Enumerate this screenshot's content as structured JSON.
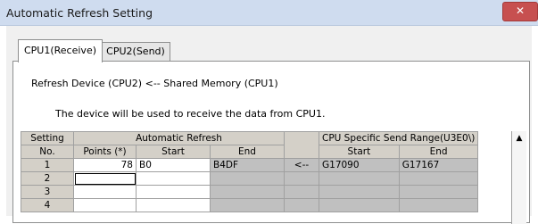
{
  "window": {
    "title": "Automatic Refresh Setting",
    "close_glyph": "✕"
  },
  "tabs": [
    {
      "label": "CPU1(Receive)",
      "active": true
    },
    {
      "label": "CPU2(Send)",
      "active": false
    }
  ],
  "panel": {
    "line1": "Refresh Device (CPU2) <-- Shared Memory (CPU1)",
    "line2": "The device will be used to receive the data from CPU1."
  },
  "table": {
    "headers": {
      "setting": "Setting",
      "no": "No.",
      "auto_refresh": "Automatic Refresh",
      "send_range": "CPU Specific Send Range(U3E0\\)",
      "points": "Points (*)",
      "start": "Start",
      "end": "End",
      "start2": "Start",
      "end2": "End"
    },
    "rows": [
      {
        "no": "1",
        "points": "78",
        "start": "B0",
        "end": "B4DF",
        "arrow": "<--",
        "r_start": "G17090",
        "r_end": "G17167"
      },
      {
        "no": "2",
        "points": "",
        "start": "",
        "end": "",
        "arrow": "",
        "r_start": "",
        "r_end": ""
      },
      {
        "no": "3",
        "points": "",
        "start": "",
        "end": "",
        "arrow": "",
        "r_start": "",
        "r_end": ""
      },
      {
        "no": "4",
        "points": "",
        "start": "",
        "end": "",
        "arrow": "",
        "r_start": "",
        "r_end": ""
      }
    ]
  },
  "scrollbar": {
    "up_glyph": "▲"
  }
}
